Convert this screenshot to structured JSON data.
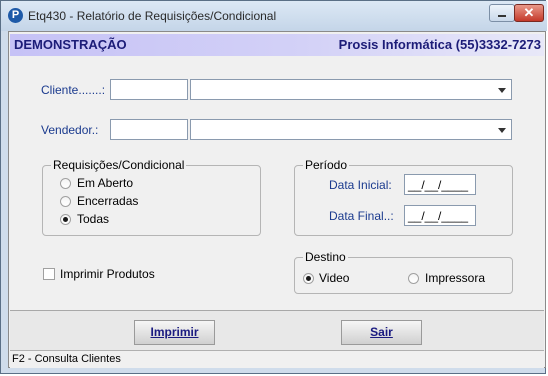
{
  "window": {
    "title": "Etq430 - Relatório de Requisições/Condicional",
    "icon": "P"
  },
  "banner": {
    "left": "DEMONSTRAÇÃO",
    "right": "Prosis Informática (55)3332-7273"
  },
  "cliente": {
    "label": "Cliente.......:",
    "code": "",
    "name": ""
  },
  "vendedor": {
    "label": "Vendedor.:",
    "code": "",
    "name": ""
  },
  "requisicoes": {
    "title": "Requisições/Condicional",
    "options": [
      "Em Aberto",
      "Encerradas",
      "Todas"
    ],
    "selected": "Todas"
  },
  "periodo": {
    "title": "Período",
    "data_inicial_label": "Data Inicial:",
    "data_inicial_value": "__/__/____",
    "data_final_label": "Data Final..:",
    "data_final_value": "__/__/____"
  },
  "imprimir_produtos": {
    "label": "Imprimir Produtos",
    "checked": false
  },
  "destino": {
    "title": "Destino",
    "options": [
      "Video",
      "Impressora"
    ],
    "selected": "Video"
  },
  "buttons": {
    "imprimir": "Imprimir",
    "sair": "Sair"
  },
  "status": "F2 - Consulta Clientes",
  "colors": {
    "banner_text": "#1c1c78",
    "label_blue": "#1a3a8e",
    "close_button": "#c4392a"
  }
}
